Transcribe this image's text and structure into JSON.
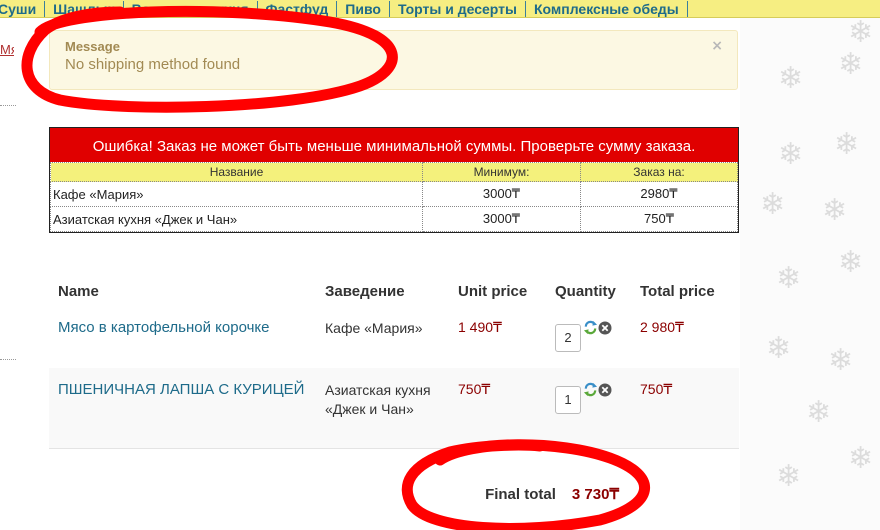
{
  "nav": {
    "items": [
      "Суши",
      "Шашлык",
      "Восточная кухня",
      "Фастфуд",
      "Пиво",
      "Торты и десерты",
      "Комплексные обеды"
    ]
  },
  "left_stub": "Мя",
  "message": {
    "title": "Message",
    "text": "No shipping method found",
    "close": "×"
  },
  "error": {
    "headline": "Ошибка! Заказ не может быть меньше минимальной суммы. Проверьте сумму заказа.",
    "columns": [
      "Название",
      "Минимум:",
      "Заказ на:"
    ],
    "rows": [
      {
        "name": "Кафе «Мария»",
        "minimum": "3000₸",
        "order": "2980₸"
      },
      {
        "name": "Азиатская кухня «Джек и Чан»",
        "minimum": "3000₸",
        "order": "750₸"
      }
    ]
  },
  "cart": {
    "headers": {
      "name": "Name",
      "venue": "Заведение",
      "unit": "Unit price",
      "qty": "Quantity",
      "total": "Total price"
    },
    "items": [
      {
        "name": "Мясо в картофельной корочке",
        "venue": "Кафе «Мария»",
        "unit": "1 490₸",
        "qty": "2",
        "total": "2 980₸"
      },
      {
        "name": "ПШЕНИЧНАЯ ЛАПША С КУРИЦЕЙ",
        "venue": "Азиатская кухня «Джек и Чан»",
        "unit": "750₸",
        "qty": "1",
        "total": "750₸"
      }
    ],
    "final_label": "Final total",
    "final_value": "3 730₸"
  },
  "icons": {
    "refresh": "refresh-icon",
    "remove": "remove-icon",
    "snowflake": "snowflake-icon"
  },
  "colors": {
    "nav_bg": "#f6ee82",
    "error_red": "#e00000",
    "price_red": "#8b0000",
    "link_blue": "#1e6b8a",
    "annotation_red": "#ff0000"
  }
}
